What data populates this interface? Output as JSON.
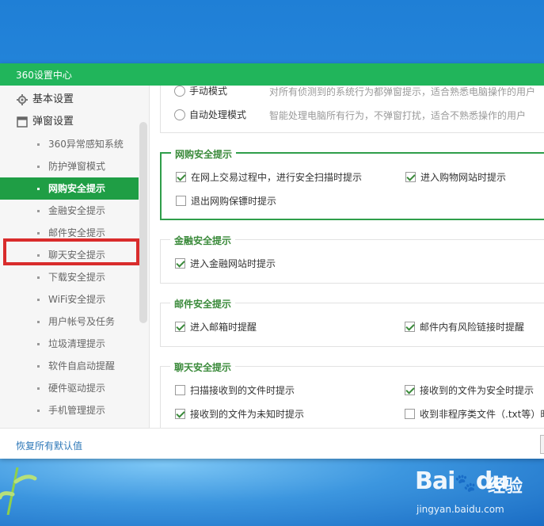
{
  "window": {
    "title": "360设置中心"
  },
  "sidebar": {
    "categories": [
      {
        "label": "基本设置",
        "icon": "gear-icon"
      },
      {
        "label": "弹窗设置",
        "icon": "window-icon"
      }
    ],
    "items": [
      {
        "label": "360异常感知系统"
      },
      {
        "label": "防护弹窗模式"
      },
      {
        "label": "网购安全提示",
        "active": true
      },
      {
        "label": "金融安全提示"
      },
      {
        "label": "邮件安全提示"
      },
      {
        "label": "聊天安全提示"
      },
      {
        "label": "下载安全提示"
      },
      {
        "label": "WiFi安全提示"
      },
      {
        "label": "用户帐号及任务"
      },
      {
        "label": "垃圾清理提示"
      },
      {
        "label": "软件自启动提醒"
      },
      {
        "label": "硬件驱动提示"
      },
      {
        "label": "手机管理提示"
      }
    ]
  },
  "mode_group": {
    "options": [
      {
        "label": "手动模式",
        "desc": "对所有侦测到的系统行为都弹窗提示，适合熟悉电脑操作的用户"
      },
      {
        "label": "自动处理模式",
        "desc": "智能处理电脑所有行为，不弹窗打扰，适合不熟悉操作的用户"
      }
    ]
  },
  "shopping_group": {
    "title": "网购安全提示",
    "options": [
      {
        "label": "在网上交易过程中，进行安全扫描时提示",
        "checked": true
      },
      {
        "label": "进入购物网站时提示",
        "checked": true
      },
      {
        "label": "退出网购保镖时提示",
        "checked": false
      }
    ]
  },
  "finance_group": {
    "title": "金融安全提示",
    "options": [
      {
        "label": "进入金融网站时提示",
        "checked": true
      }
    ]
  },
  "mail_group": {
    "title": "邮件安全提示",
    "options": [
      {
        "label": "进入邮箱时提醒",
        "checked": true
      },
      {
        "label": "邮件内有风险链接时提醒",
        "checked": true
      }
    ]
  },
  "chat_group": {
    "title": "聊天安全提示",
    "options": [
      {
        "label": "扫描接收到的文件时提示",
        "checked": false
      },
      {
        "label": "接收到的文件为安全时提示",
        "checked": true
      },
      {
        "label": "接收到的文件为未知时提示",
        "checked": true
      },
      {
        "label": "收到非程序类文件（.txt等）时",
        "checked": false
      }
    ]
  },
  "footer": {
    "reset_label": "恢复所有默认值"
  },
  "watermark": {
    "logo": "Bai",
    "logo2": "du",
    "cn": "经验",
    "url": "jingyan.baidu.com"
  },
  "colors": {
    "titlebar": "#21b55b",
    "active_item": "#1f9e45",
    "highlight": "#d92c2c",
    "group_border": "#2f9e4a"
  }
}
